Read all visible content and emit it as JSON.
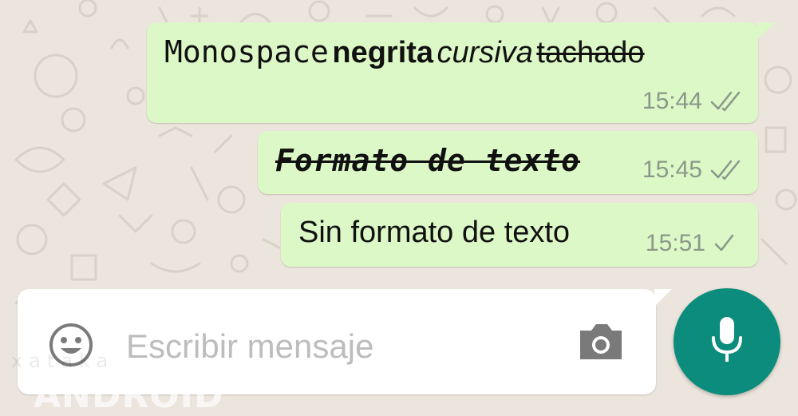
{
  "messages": [
    {
      "segments": {
        "monospace": "Monospace",
        "bold": "negrita",
        "italic": "cursiva",
        "strikethrough": "tachado"
      },
      "time": "15:44",
      "status": "double-check-icon"
    },
    {
      "text": "Formato de texto",
      "time": "15:45",
      "status": "double-check-icon"
    },
    {
      "text": "Sin formato de texto",
      "time": "15:51",
      "status": "check-icon"
    }
  ],
  "composer": {
    "placeholder": "Escribir mensaje",
    "emoji_icon": "emoji-icon",
    "camera_icon": "camera-icon",
    "mic_icon": "microphone-icon"
  },
  "watermark": {
    "top": "xataka",
    "main": "ANDROID"
  },
  "colors": {
    "background": "#ece5dd",
    "outgoing_bubble": "#dcf8c6",
    "accent": "#0b8c7c",
    "meta_text": "#8b978a"
  }
}
